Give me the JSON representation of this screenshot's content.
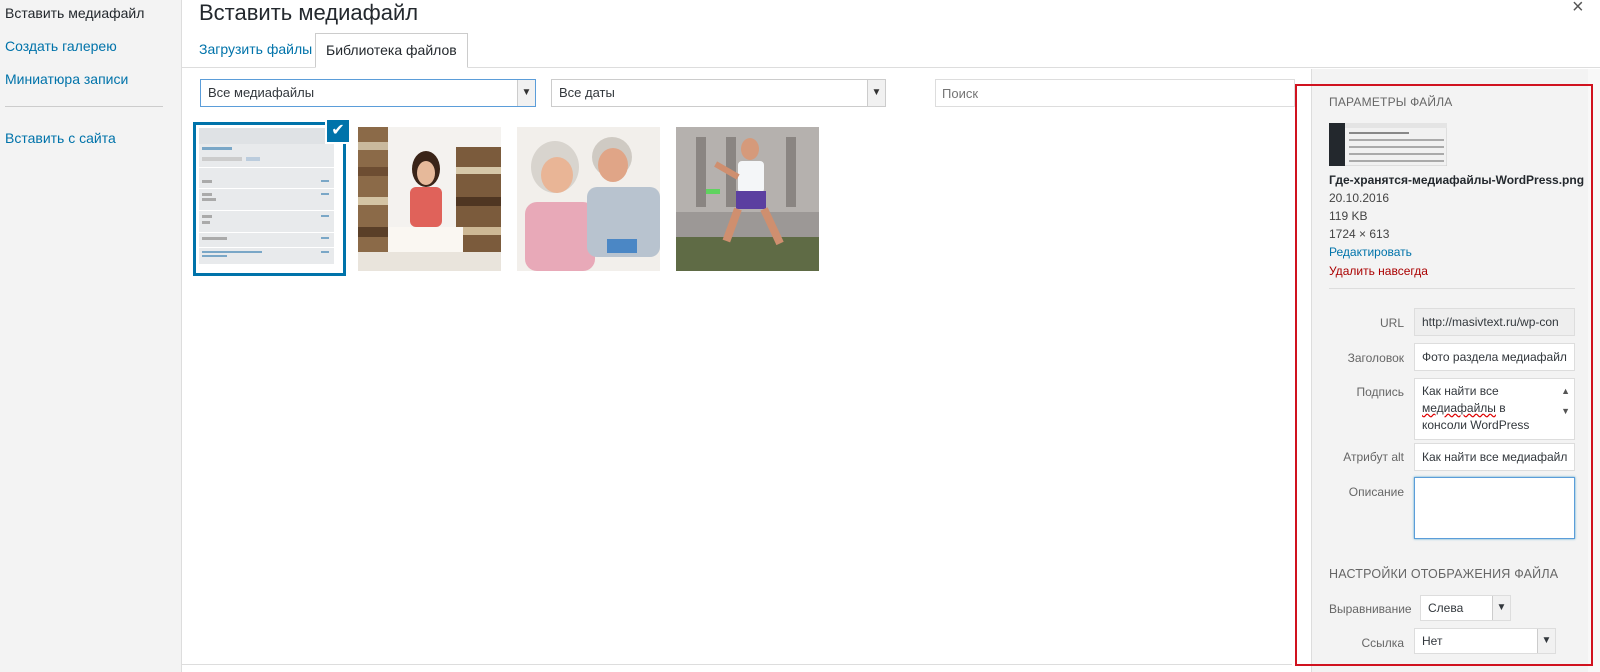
{
  "menu": {
    "items": [
      {
        "label": "Вставить медиафайл"
      },
      {
        "label": "Создать галерею"
      },
      {
        "label": "Миниатюра записи"
      },
      {
        "label": "Вставить с сайта"
      }
    ]
  },
  "frame": {
    "title": "Вставить медиафайл",
    "close": "×",
    "tabs": [
      {
        "label": "Загрузить файлы"
      },
      {
        "label": "Библиотека файлов"
      }
    ]
  },
  "toolbar": {
    "filter_type": "Все медиафайлы",
    "filter_date": "Все даты",
    "search_placeholder": "Поиск"
  },
  "library": {
    "check": "✔"
  },
  "details": {
    "heading": "Параметры файла",
    "filename": "Где-хранятся-медиафайлы-WordPress.png",
    "date": "20.10.2016",
    "size": "119 KB",
    "dimensions": "1724 × 613",
    "edit_link": "Редактировать",
    "delete_link": "Удалить навсегда",
    "fields": {
      "url_label": "URL",
      "url_value": "http://masivtext.ru/wp-con",
      "title_label": "Заголовок",
      "title_value": "Фото раздела медиафайл",
      "caption_label": "Подпись",
      "caption_l1": "Как найти все",
      "caption_l2": "медиафайлы",
      "caption_l2b": " в",
      "caption_l3": "консоли WordPress",
      "alt_label": "Атрибут alt",
      "alt_value": "Как найти все медиафайл",
      "desc_label": "Описание",
      "desc_value": ""
    }
  },
  "display": {
    "heading": "Настройки отображения файла",
    "align_label": "Выравнивание",
    "align_value": "Слева",
    "link_label": "Ссылка",
    "link_value": "Нет"
  },
  "colors": {
    "link": "#0073aa",
    "delete": "#aa0000",
    "highlight_frame": "#d0121f"
  }
}
